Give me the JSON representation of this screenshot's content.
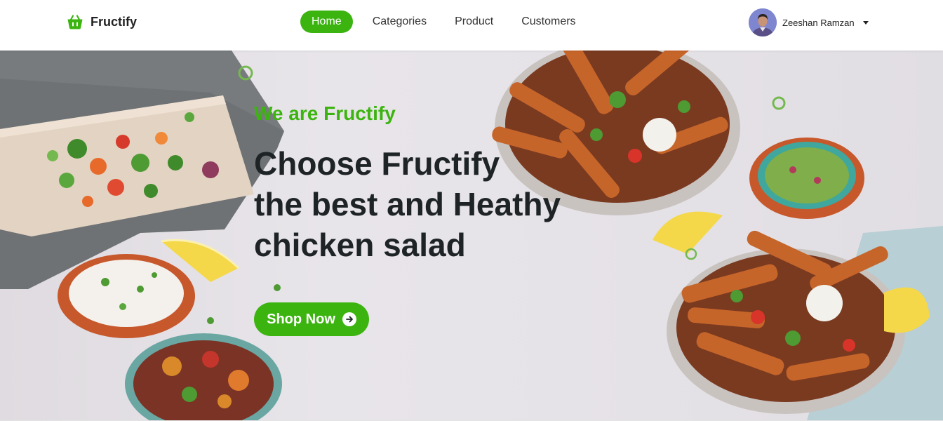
{
  "brand": {
    "name": "Fructify",
    "icon": "basket-icon",
    "color": "#3cb410"
  },
  "nav": {
    "items": [
      {
        "label": "Home",
        "active": true
      },
      {
        "label": "Categories",
        "active": false
      },
      {
        "label": "Product",
        "active": false
      },
      {
        "label": "Customers",
        "active": false
      }
    ]
  },
  "user": {
    "name": "Zeeshan Ramzan",
    "icon": "caret-down-icon"
  },
  "hero": {
    "tagline": "We are Fructify",
    "headline": [
      "Choose Fructify",
      "the best and Heathy",
      "chicken salad"
    ],
    "cta_label": "Shop Now",
    "cta_icon": "arrow-right-circle-icon"
  },
  "colors": {
    "accent": "#3cb410",
    "heading": "#1e2426"
  }
}
